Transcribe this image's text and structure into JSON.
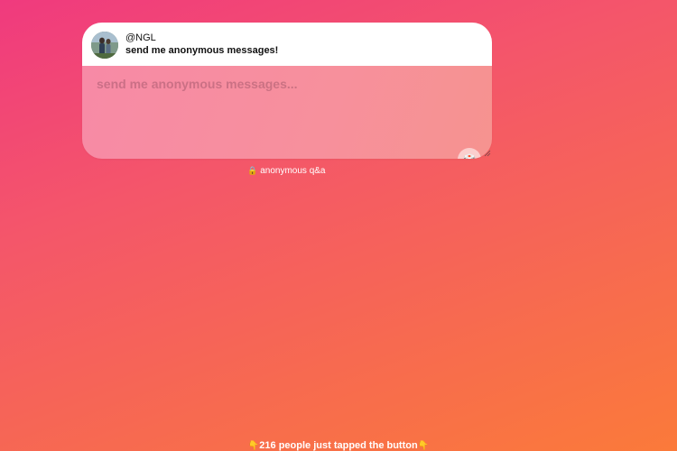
{
  "profile": {
    "username": "@NGL",
    "prompt": "send me anonymous messages!"
  },
  "message": {
    "placeholder": "send me anonymous messages...",
    "value": ""
  },
  "dice": {
    "icon": "dice-icon",
    "glyph": "🎲"
  },
  "tagline": {
    "icon": "lock-icon",
    "glyph": "🔒",
    "text": "anonymous q&a"
  },
  "footer": {
    "icon": "point-down-icon",
    "glyph": "👇",
    "text": "216 people just tapped the button"
  },
  "colors": {
    "background_start": "#f03a7e",
    "background_end": "#fb7a3a",
    "card_body": "#f78fa0"
  }
}
